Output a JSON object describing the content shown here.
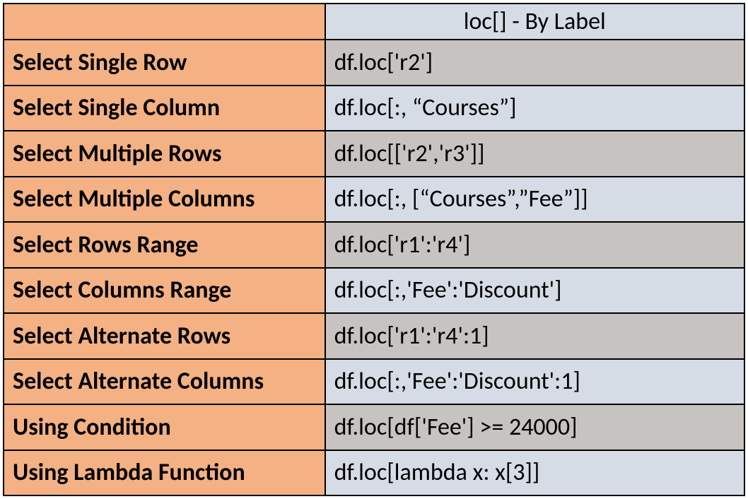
{
  "table": {
    "header": "loc[] - By Label",
    "rows": [
      {
        "label": "Select Single Row",
        "code": "df.loc['r2']"
      },
      {
        "label": "Select Single Column",
        "code": "df.loc[:, “Courses”]"
      },
      {
        "label": "Select Multiple Rows",
        "code": "df.loc[['r2','r3']]"
      },
      {
        "label": "Select Multiple Columns",
        "code": "df.loc[:, [“Courses”,”Fee”]]"
      },
      {
        "label": "Select Rows Range",
        "code": "df.loc['r1':'r4']"
      },
      {
        "label": "Select Columns Range",
        "code": "df.loc[:,'Fee':'Discount']"
      },
      {
        "label": "Select Alternate Rows",
        "code": "df.loc['r1':'r4':1]"
      },
      {
        "label": "Select Alternate Columns",
        "code": "df.loc[:,'Fee':'Discount':1]"
      },
      {
        "label": "Using Condition",
        "code": "df.loc[df['Fee'] >= 24000]"
      },
      {
        "label": "Using Lambda Function",
        "code": "df.loc[lambda x: x[3]]"
      }
    ]
  }
}
